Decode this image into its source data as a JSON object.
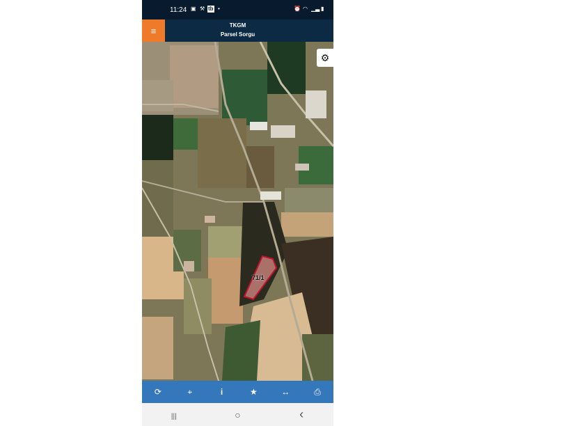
{
  "status_bar": {
    "time": "11:24",
    "left_icons": [
      "image-icon",
      "transfer-icon",
      "tb-icon",
      "dot-icon"
    ],
    "tb_label": "tb",
    "right_icons": [
      "alarm-icon",
      "wifi-icon",
      "signal-icon",
      "battery-icon"
    ]
  },
  "header": {
    "title": "TKGM",
    "subtitle": "Parsel Sorgu",
    "menu_icon": "hamburger-icon",
    "accent_color": "#ef7a2a",
    "bar_color": "#0d2a44"
  },
  "map": {
    "parcel_label": "71/1",
    "parcel_color": "#c0142c",
    "settings_icon": "gear-icon"
  },
  "toolbar": {
    "color": "#3577bb",
    "buttons": [
      {
        "icon": "refresh-icon",
        "glyph": "⟳"
      },
      {
        "icon": "crosshair-icon",
        "glyph": "⌖"
      },
      {
        "icon": "info-icon",
        "glyph": "i"
      },
      {
        "icon": "star-icon",
        "glyph": "★"
      },
      {
        "icon": "measure-icon",
        "glyph": "↔"
      },
      {
        "icon": "print-icon",
        "glyph": "⎙"
      }
    ]
  },
  "nav_bar": {
    "recents_glyph": "|||",
    "home_glyph": "○",
    "back_glyph": "‹"
  }
}
